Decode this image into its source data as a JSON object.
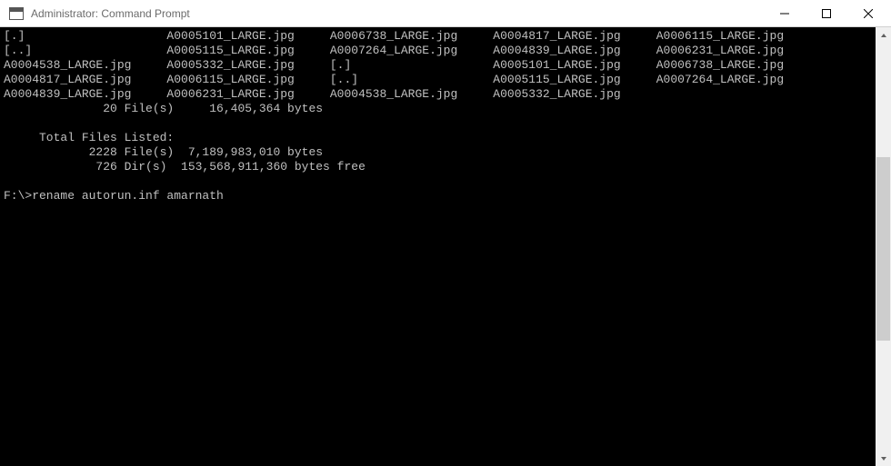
{
  "window": {
    "title": "Administrator: Command Prompt"
  },
  "terminal": {
    "rows": [
      [
        "[.]",
        "A0005101_LARGE.jpg",
        "A0006738_LARGE.jpg",
        "A0004817_LARGE.jpg",
        "A0006115_LARGE.jpg"
      ],
      [
        "[..]",
        "A0005115_LARGE.jpg",
        "A0007264_LARGE.jpg",
        "A0004839_LARGE.jpg",
        "A0006231_LARGE.jpg"
      ],
      [
        "A0004538_LARGE.jpg",
        "A0005332_LARGE.jpg",
        "[.]",
        "A0005101_LARGE.jpg",
        "A0006738_LARGE.jpg"
      ],
      [
        "A0004817_LARGE.jpg",
        "A0006115_LARGE.jpg",
        "[..]",
        "A0005115_LARGE.jpg",
        "A0007264_LARGE.jpg"
      ],
      [
        "A0004839_LARGE.jpg",
        "A0006231_LARGE.jpg",
        "A0004538_LARGE.jpg",
        "A0005332_LARGE.jpg",
        ""
      ]
    ],
    "summary1": "              20 File(s)     16,405,364 bytes",
    "blank1": "",
    "totalHeader": "     Total Files Listed:",
    "totalFiles": "            2228 File(s)  7,189,983,010 bytes",
    "totalDirs": "             726 Dir(s)  153,568,911,360 bytes free",
    "blank2": "",
    "prompt": "F:\\>rename autorun.inf amarnath"
  },
  "scrollbar": {
    "thumbTop": "28%",
    "thumbHeight": "45%"
  }
}
